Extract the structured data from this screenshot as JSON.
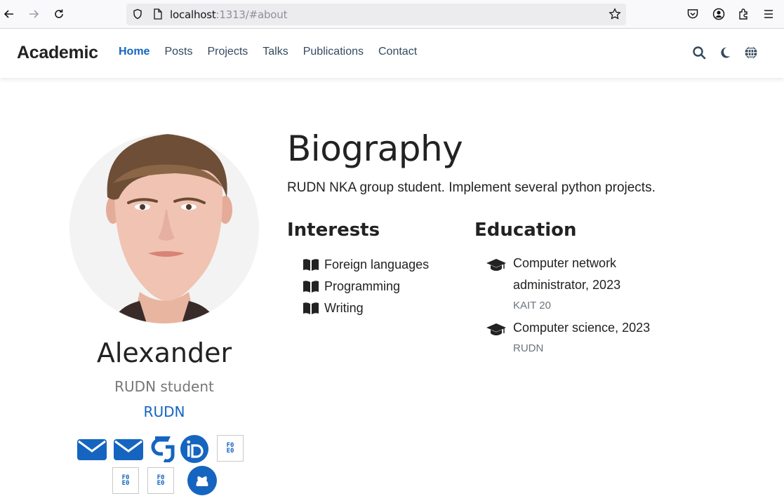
{
  "browser": {
    "url_host": "localhost",
    "url_rest": ":1313/#about",
    "icons": [
      "back-arrow-icon",
      "forward-arrow-icon",
      "reload-icon",
      "shield-icon",
      "page-icon",
      "bookmark-star-icon",
      "pocket-icon",
      "account-icon",
      "extensions-icon",
      "hamburger-menu-icon"
    ]
  },
  "nav": {
    "brand": "Academic",
    "items": [
      {
        "label": "Home",
        "active": true
      },
      {
        "label": "Posts",
        "active": false
      },
      {
        "label": "Projects",
        "active": false
      },
      {
        "label": "Talks",
        "active": false
      },
      {
        "label": "Publications",
        "active": false
      },
      {
        "label": "Contact",
        "active": false
      }
    ],
    "right_icons": [
      "search-icon",
      "moon-icon",
      "globe-icon"
    ]
  },
  "profile": {
    "name": "Alexander",
    "role": "RUDN student",
    "organization": "RUDN",
    "social_icons": [
      "envelope-icon",
      "envelope-icon",
      "google-scholar-icon",
      "orcid-icon",
      "missing-icon",
      "missing-icon",
      "missing-icon",
      "github-icon"
    ],
    "placeholder_glyph": "F0\nE0"
  },
  "biography": {
    "title": "Biography",
    "text": "RUDN NKA group student. Implement several python projects."
  },
  "interests": {
    "title": "Interests",
    "items": [
      "Foreign languages",
      "Programming",
      "Writing"
    ]
  },
  "education": {
    "title": "Education",
    "items": [
      {
        "course_line1": "Computer network",
        "course_line2": "administrator, 2023",
        "institution": "KAIT 20"
      },
      {
        "course_line1": "Computer science, 2023",
        "institution": "RUDN"
      }
    ]
  },
  "colors": {
    "accent": "#1565c0",
    "text": "#222222",
    "muted": "#777777"
  }
}
